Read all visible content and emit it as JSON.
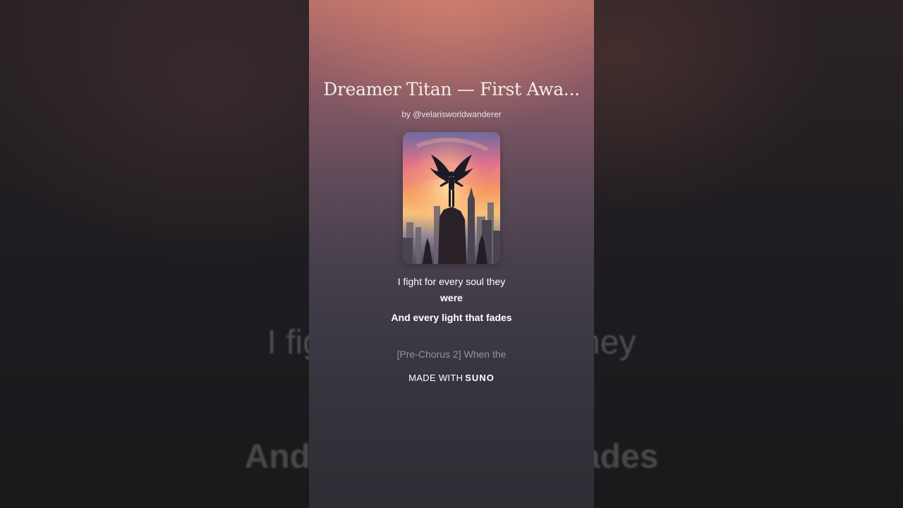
{
  "song": {
    "title": "Dreamer Titan — First Awa...",
    "byline": "by @velarisworldwanderer"
  },
  "lyrics": {
    "line1": "I fight for every soul they",
    "line1_cont": "were",
    "line2": "And every light that fades",
    "next_line": "[Pre-Chorus 2] When the"
  },
  "background_lyrics": {
    "line1": "I fight for every soul they",
    "line2": "And every light that fades"
  },
  "footer": {
    "made_with": "MADE WITH",
    "brand": "SUNO"
  },
  "colors": {
    "panel_top": "#b8706a",
    "panel_bottom": "#2d2d34",
    "text": "#ffffff"
  },
  "icons": {
    "cover_art": "winged-titan-over-city-at-sunset"
  }
}
